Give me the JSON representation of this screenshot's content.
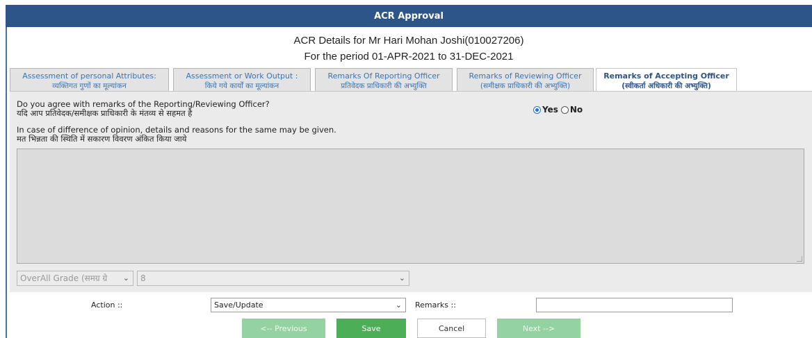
{
  "window": {
    "title": "ACR Approval"
  },
  "header": {
    "line1": "ACR Details for Mr Hari Mohan Joshi(010027206)",
    "line2": "For the period 01-APR-2021 to 31-DEC-2021"
  },
  "tabs": [
    {
      "line1": "Assessment of personal Attributes:",
      "line2": "व्यक्तिगत गुणों का मूल्यांकन"
    },
    {
      "line1": "Assessment or Work Output :",
      "line2": "किये गये कार्यों का मूल्यांकन"
    },
    {
      "line1": "Remarks Of Reporting Officer",
      "line2": "प्रतिवेदक प्राधिकारी की अभ्युक्ति"
    },
    {
      "line1": "Remarks of Reviewing Officer",
      "line2": "(समीक्षक प्राधिकारी की अभ्युक्ति)"
    },
    {
      "line1": "Remarks of Accepting Officer",
      "line2": "(स्वीकर्ता अधिकारी की अभ्युक्ति)",
      "active": true
    }
  ],
  "form": {
    "question1_en": "Do you agree with remarks of the Reporting/Reviewing Officer?",
    "question1_hi": "यदि आप प्रतिवेदक/समीक्षक प्राधिकारी के मंतव्य से सहमत है",
    "yes_label": "Yes",
    "no_label": "No",
    "selected": "Yes",
    "question2_en": "In case of difference of opinion, details and reasons for the same may be given.",
    "question2_hi": "मत भिन्नता की स्थिति में सकारण विवरण अंकित किया जाये",
    "grade_label": "OverAll Grade (समग्र ग्रे",
    "grade_value": "8"
  },
  "actions": {
    "action_label": "Action ::",
    "action_value": "Save/Update",
    "remarks_label": "Remarks ::",
    "remarks_value": "",
    "prev_label": "<-- Previous",
    "save_label": "Save",
    "cancel_label": "Cancel",
    "next_label": "Next -->"
  },
  "colors": {
    "titlebar": "#2e5589",
    "save": "#4cae57",
    "nav_disabled": "#94d3a1",
    "tab_text": "#3b73b1"
  }
}
